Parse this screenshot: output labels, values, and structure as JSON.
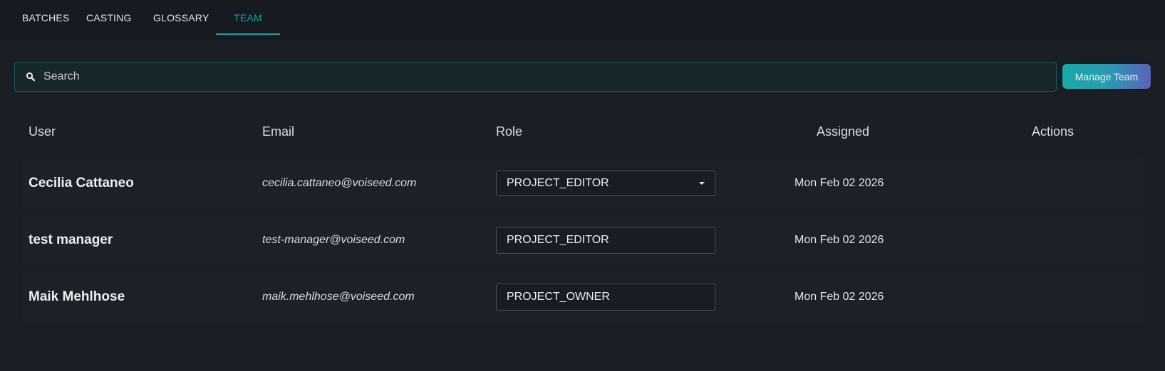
{
  "tabs": [
    {
      "label": "BATCHES",
      "active": false
    },
    {
      "label": "CASTING",
      "active": false
    },
    {
      "label": "GLOSSARY",
      "active": false
    },
    {
      "label": "TEAM",
      "active": true
    }
  ],
  "search": {
    "placeholder": "Search",
    "icon": "search-icon"
  },
  "manage_button": "Manage Team",
  "columns": {
    "user": "User",
    "email": "Email",
    "role": "Role",
    "assigned": "Assigned",
    "actions": "Actions"
  },
  "rows": [
    {
      "name": "Cecilia Cattaneo",
      "email": "cecilia.cattaneo@voiseed.com",
      "role": "PROJECT_EDITOR",
      "role_dropdown": true,
      "assigned": "Mon Feb 02 2026"
    },
    {
      "name": "test manager",
      "email": "test-manager@voiseed.com",
      "role": "PROJECT_EDITOR",
      "role_dropdown": false,
      "assigned": "Mon Feb 02 2026"
    },
    {
      "name": "Maik Mehlhose",
      "email": "maik.mehlhose@voiseed.com",
      "role": "PROJECT_OWNER",
      "role_dropdown": false,
      "assigned": "Mon Feb 02 2026"
    }
  ],
  "colors": {
    "accent": "#19a2a6",
    "background": "#1b1e25",
    "tabbar": "#171a20",
    "row": "#1d2027"
  }
}
